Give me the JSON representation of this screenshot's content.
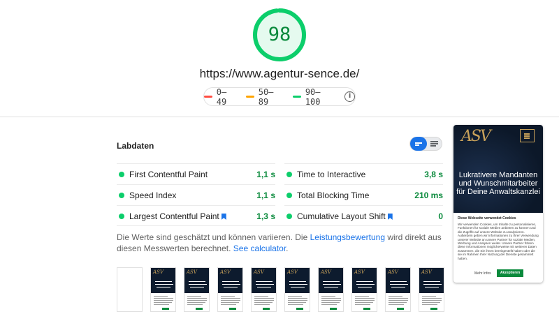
{
  "score": {
    "value": "98",
    "fraction": 0.98,
    "color": "#0cce6b"
  },
  "url": "https://www.agentur-sence.de/",
  "legend": {
    "items": [
      {
        "label": "0–49",
        "color": "#ff4e42"
      },
      {
        "label": "50–89",
        "color": "#ffa400"
      },
      {
        "label": "90–100",
        "color": "#0cce6b"
      }
    ],
    "info_icon": "info-icon"
  },
  "labdata": {
    "title": "Labdaten",
    "metrics": [
      {
        "name": "First Contentful Paint",
        "value": "1,1 s",
        "bookmark": false
      },
      {
        "name": "Time to Interactive",
        "value": "3,8 s",
        "bookmark": false
      },
      {
        "name": "Speed Index",
        "value": "1,1 s",
        "bookmark": false
      },
      {
        "name": "Total Blocking Time",
        "value": "210 ms",
        "bookmark": false
      },
      {
        "name": "Largest Contentful Paint",
        "value": "1,3 s",
        "bookmark": true
      },
      {
        "name": "Cumulative Layout Shift",
        "value": "0",
        "bookmark": true
      }
    ],
    "note": {
      "text_before": "Die Werte sind geschätzt und können variieren. Die ",
      "link1": "Leistungsbewertung",
      "text_middle": " wird direkt aus diesen Messwerten berechnet. ",
      "link2": "See calculator",
      "text_after": "."
    }
  },
  "preview": {
    "logo": "ASV",
    "heading": "Lukrativere Mandanten und Wunschmitarbeiter für Deine Anwaltskanzlei",
    "cookie_title": "Diese Webseite verwendet Cookies",
    "cookie_text": "Wir verwenden Cookies, um Inhalte zu personalisieren, Funktionen für soziale Medien anbieten zu können und die Zugriffe auf unsere Website zu analysieren. Außerdem geben wir Informationen zu Ihrer Verwendung unserer Website an unsere Partner für soziale Medien, Werbung und Analysen weiter. Unsere Partner führen diese Informationen möglicherweise mit weiteren Daten zusammen, die Sie ihnen bereitgestellt haben oder die sie im Rahmen Ihrer Nutzung der Dienste gesammelt haben.",
    "more_label": "Mehr Infos",
    "accept_label": "Akzeptieren"
  },
  "filmstrip": {
    "frame_logo": "ASV"
  }
}
